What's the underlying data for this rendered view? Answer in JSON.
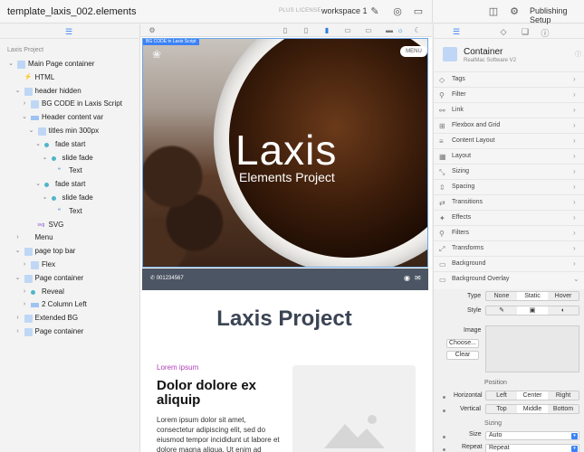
{
  "topbar": {
    "title": "template_laxis_002.elements",
    "plus": "PLUS LICENSE",
    "workspace": "workspace 1",
    "publish": "Publishing Setup"
  },
  "left": {
    "project": "Laxis Project",
    "tree": [
      {
        "label": "Main Page container",
        "depth": 0,
        "caret": "v",
        "icon": "sq"
      },
      {
        "label": "HTML",
        "depth": 1,
        "caret": "",
        "icon": "html"
      },
      {
        "label": "header hidden",
        "depth": 1,
        "caret": "v",
        "icon": "sq"
      },
      {
        "label": "BG CODE in Laxis Script",
        "depth": 2,
        "caret": ">",
        "icon": "sq"
      },
      {
        "label": "Header content var",
        "depth": 2,
        "caret": "v",
        "icon": "bar"
      },
      {
        "label": "titles min 300px",
        "depth": 3,
        "caret": "v",
        "icon": "sq"
      },
      {
        "label": "fade start",
        "depth": 4,
        "caret": "v",
        "icon": "dot"
      },
      {
        "label": "slide fade",
        "depth": 5,
        "caret": "v",
        "icon": "dot"
      },
      {
        "label": "Text",
        "depth": 6,
        "caret": "",
        "icon": "tx"
      },
      {
        "label": "fade start",
        "depth": 4,
        "caret": "v",
        "icon": "dot"
      },
      {
        "label": "slide fade",
        "depth": 5,
        "caret": "v",
        "icon": "dot"
      },
      {
        "label": "Text",
        "depth": 6,
        "caret": "",
        "icon": "tx"
      },
      {
        "label": "SVG",
        "depth": 3,
        "caret": "",
        "icon": "svg"
      },
      {
        "label": "Menu",
        "depth": 1,
        "caret": ">",
        "icon": "none"
      },
      {
        "label": "page top bar",
        "depth": 1,
        "caret": "v",
        "icon": "sq"
      },
      {
        "label": "Flex",
        "depth": 2,
        "caret": ">",
        "icon": "sq"
      },
      {
        "label": "Page container",
        "depth": 1,
        "caret": "v",
        "icon": "sq"
      },
      {
        "label": "Reveal",
        "depth": 2,
        "caret": ">",
        "icon": "dot"
      },
      {
        "label": "2 Column Left",
        "depth": 2,
        "caret": ">",
        "icon": "bar"
      },
      {
        "label": "Extended BG",
        "depth": 1,
        "caret": ">",
        "icon": "sq"
      },
      {
        "label": "Page container",
        "depth": 1,
        "caret": ">",
        "icon": "sq"
      }
    ]
  },
  "center": {
    "badge": "BG CODE in Laxis Script",
    "menu": "MENU",
    "hero_title": "Laxis",
    "hero_sub": "Elements Project",
    "phone": "001234567",
    "page_title": "Laxis Project",
    "lorem_small": "Lorem ipsum",
    "heading": "Dolor dolore ex aliquip",
    "paragraph": "Lorem ipsum dolor sit amet, consectetur adipiscing elit, sed do eiusmod tempor incididunt ut labore et dolore magna aliqua. Ut enim ad minim veniam, quis"
  },
  "right": {
    "title": "Container",
    "subtitle": "RealMac Software   V2",
    "sections": [
      "Tags",
      "Filter",
      "Link",
      "Flexbox and Grid",
      "Content Layout",
      "Layout",
      "Sizing",
      "Spacing",
      "Transitions",
      "Effects",
      "Filters",
      "Transforms",
      "Background",
      "Background Overlay"
    ],
    "type_label": "Type",
    "type_opts": [
      "None",
      "Static",
      "Hover"
    ],
    "style_label": "Style",
    "image_label": "Image",
    "choose": "Choose...",
    "clear": "Clear",
    "position_h": "Position",
    "horiz_label": "Horizontal",
    "horiz_opts": [
      "Left",
      "Center",
      "Right"
    ],
    "vert_label": "Vertical",
    "vert_opts": [
      "Top",
      "Middle",
      "Bottom"
    ],
    "sizing_h": "Sizing",
    "size_label": "Size",
    "size_val": "Auto",
    "repeat_label": "Repeat",
    "repeat_val": "Repeat"
  }
}
